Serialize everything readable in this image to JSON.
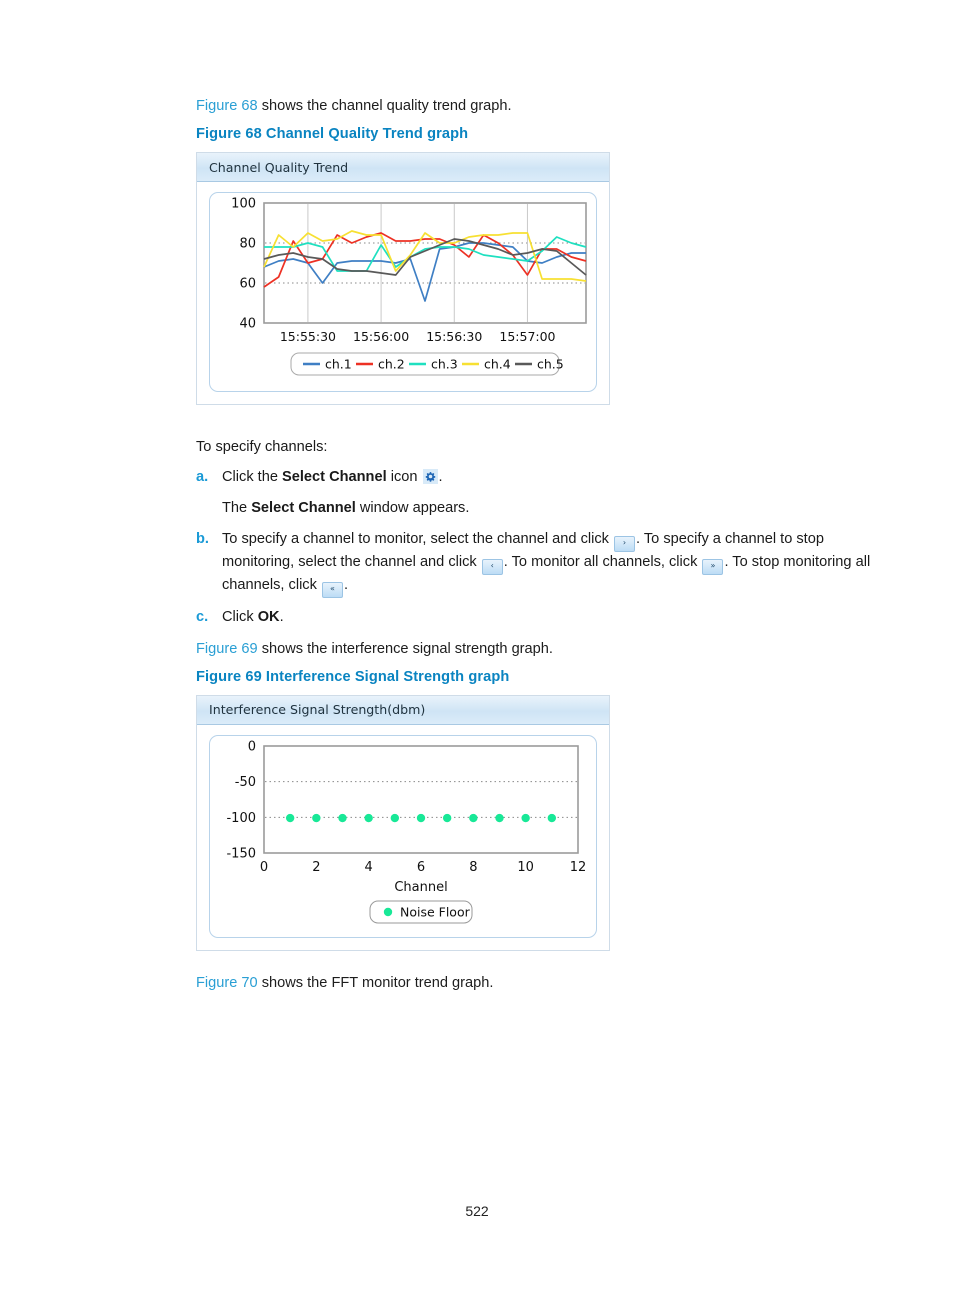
{
  "document": {
    "page_number": "522"
  },
  "intro": {
    "fig68_ref": "Figure 68",
    "fig68_sentence": " shows the channel quality trend graph.",
    "fig68_caption": "Figure 68 Channel Quality Trend graph",
    "fig69_ref": "Figure 69",
    "fig69_sentence": " shows the interference signal strength graph.",
    "fig69_caption": "Figure 69 Interference Signal Strength graph",
    "fig70_ref": "Figure 70",
    "fig70_sentence": " shows the FFT monitor trend graph."
  },
  "procedure": {
    "lead": "To specify channels:",
    "steps": [
      {
        "marker": "a.",
        "text_1": "Click the ",
        "bold_1": "Select Channel",
        "text_2": " icon ",
        "text_3": ".",
        "icon": "gear-icon",
        "sub_text_1": "The ",
        "sub_bold_1": "Select Channel",
        "sub_text_2": " window appears."
      },
      {
        "marker": "b.",
        "text_1": "To specify a channel to monitor, select the channel and click ",
        "icon_1": "arrow-right-icon",
        "text_2": ". To specify a channel to stop monitoring, select the channel and click ",
        "icon_2": "arrow-left-icon",
        "text_3": ". To monitor all channels, click ",
        "icon_3": "arrow-double-right-icon",
        "text_4": ". To stop monitoring all channels, click ",
        "icon_4": "arrow-double-left-icon",
        "text_5": "."
      },
      {
        "marker": "c.",
        "text_1": "Click ",
        "bold_1": "OK",
        "text_2": "."
      }
    ]
  },
  "chart_data": [
    {
      "type": "line",
      "title": "Channel Quality Trend",
      "xlabel": "",
      "ylabel": "",
      "ylim": [
        40,
        100
      ],
      "yticks": [
        40,
        60,
        80,
        100
      ],
      "gridlines_y": [
        60,
        80
      ],
      "grid": true,
      "legend_position": "bottom",
      "x_tick_labels": [
        "15:55:30",
        "15:56:00",
        "15:56:30",
        "15:57:00"
      ],
      "x_tick_positions": [
        3,
        8,
        13,
        18
      ],
      "x_points": 23,
      "series": [
        {
          "name": "ch.1",
          "color": "#3f7fc4",
          "values": [
            68,
            71,
            72,
            70,
            60,
            70,
            71,
            71,
            71,
            70,
            72,
            51,
            77,
            78,
            80,
            80,
            79,
            78,
            71,
            70,
            73,
            75,
            75
          ]
        },
        {
          "name": "ch.2",
          "color": "#ed3124",
          "values": [
            58,
            63,
            81,
            70,
            72,
            84,
            80,
            83,
            85,
            81,
            81,
            82,
            82,
            79,
            73,
            84,
            80,
            74,
            64,
            77,
            77,
            73,
            71
          ]
        },
        {
          "name": "ch.3",
          "color": "#1fe0c0",
          "values": [
            78,
            78,
            78,
            80,
            78,
            66,
            66,
            66,
            79,
            68,
            73,
            77,
            78,
            78,
            77,
            74,
            73,
            72,
            71,
            76,
            83,
            80,
            78
          ]
        },
        {
          "name": "ch.4",
          "color": "#f7e032",
          "values": [
            68,
            84,
            78,
            85,
            81,
            82,
            86,
            84,
            84,
            66,
            74,
            85,
            80,
            80,
            83,
            84,
            84,
            85,
            85,
            62,
            62,
            62,
            61
          ]
        },
        {
          "name": "ch.5",
          "color": "#595959",
          "values": [
            72,
            74,
            75,
            73,
            72,
            67,
            66,
            66,
            65,
            64,
            73,
            76,
            79,
            82,
            81,
            79,
            77,
            74,
            75,
            77,
            76,
            70,
            64
          ]
        }
      ]
    },
    {
      "type": "scatter",
      "title": "Interference Signal Strength(dbm)",
      "xlabel": "Channel",
      "ylabel": "",
      "ylim": [
        -150,
        0
      ],
      "yticks": [
        -150,
        -100,
        -50,
        0
      ],
      "gridlines_y": [
        -100,
        -50
      ],
      "xlim": [
        0,
        12
      ],
      "xticks": [
        0,
        2,
        4,
        6,
        8,
        10,
        12
      ],
      "grid": true,
      "legend_position": "bottom",
      "series": [
        {
          "name": "Noise Floor",
          "color": "#18e897",
          "x": [
            1,
            2,
            3,
            4,
            5,
            6,
            7,
            8,
            9,
            10,
            11
          ],
          "y": [
            -101,
            -101,
            -101,
            -101,
            -101,
            -101,
            -101,
            -101,
            -101,
            -101,
            -101
          ]
        }
      ]
    }
  ]
}
